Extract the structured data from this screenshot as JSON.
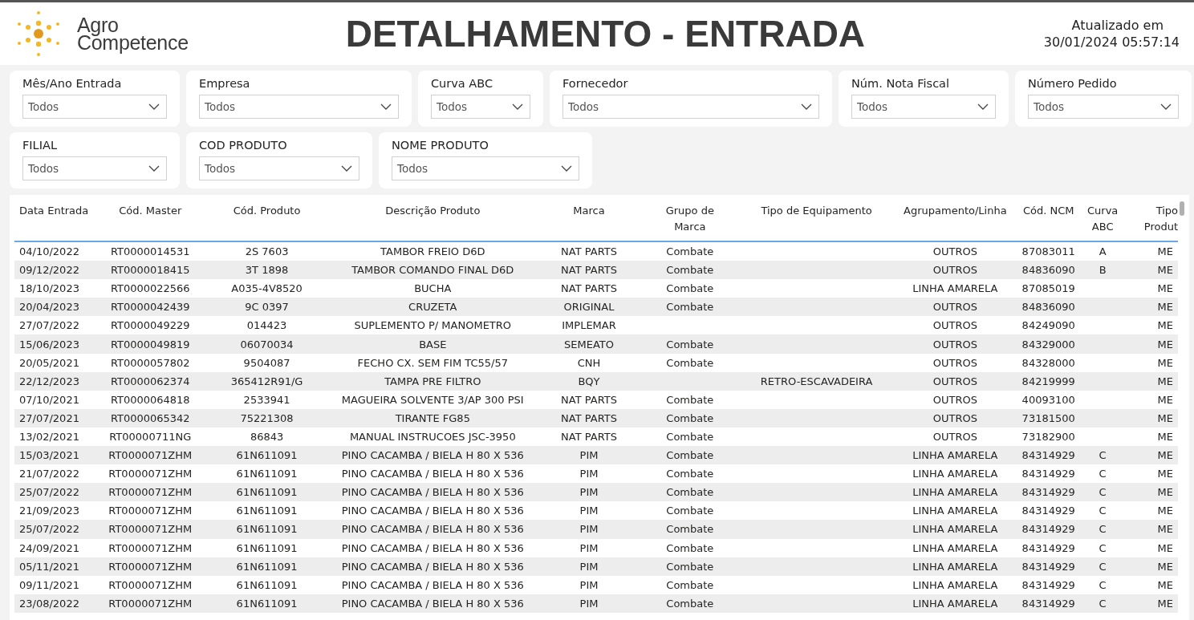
{
  "logo": {
    "line_1": "Agro",
    "line_2": "Competence"
  },
  "title": "DETALHAMENTO - ENTRADA",
  "updated": {
    "label": "Atualizado em",
    "value": "30/01/2024 05:57:14"
  },
  "filter_rows": [
    [
      {
        "label": "Mês/Ano Entrada",
        "value": "Todos"
      },
      {
        "label": "Empresa",
        "value": "Todos"
      },
      {
        "label": "Curva ABC",
        "value": "Todos"
      },
      {
        "label": "Fornecedor",
        "value": "Todos"
      },
      {
        "label": "Núm. Nota Fiscal",
        "value": "Todos"
      },
      {
        "label": "Número Pedido",
        "value": "Todos"
      }
    ],
    [
      {
        "label": "FILIAL",
        "value": "Todos"
      },
      {
        "label": "COD PRODUTO",
        "value": "Todos"
      },
      {
        "label": "NOME PRODUTO",
        "value": "Todos"
      }
    ]
  ],
  "table": {
    "columns": [
      "Data Entrada",
      "Cód. Master",
      "Cód. Produto",
      "Descrição Produto",
      "Marca",
      "Grupo de Marca",
      "Tipo de Equipamento",
      "Agrupamento/Linha",
      "Cód. NCM",
      "Curva ABC",
      "Tipo Produt"
    ],
    "rows": [
      {
        "date": "04/10/2022",
        "master": "RT0000014531",
        "product_code": "2S 7603",
        "description": "TAMBOR FREIO D6D",
        "brand": "NAT PARTS",
        "brand_group": "Combate",
        "line": "OUTROS",
        "ncm": "87083011",
        "abc": "A",
        "product_type": "ME"
      },
      {
        "date": "09/12/2022",
        "master": "RT0000018415",
        "product_code": "3T 1898",
        "description": "TAMBOR COMANDO FINAL D6D",
        "brand": "NAT PARTS",
        "brand_group": "Combate",
        "line": "OUTROS",
        "ncm": "84836090",
        "abc": "B",
        "product_type": "ME"
      },
      {
        "date": "18/10/2023",
        "master": "RT0000022566",
        "product_code": "A035-4V8520",
        "description": "BUCHA",
        "brand": "NAT PARTS",
        "brand_group": "Combate",
        "line": "LINHA AMARELA",
        "ncm": "87085019",
        "product_type": "ME"
      },
      {
        "date": "20/04/2023",
        "master": "RT0000042439",
        "product_code": "9C 0397",
        "description": "CRUZETA",
        "brand": "ORIGINAL",
        "brand_group": "Combate",
        "line": "OUTROS",
        "ncm": "84836090",
        "product_type": "ME"
      },
      {
        "date": "27/07/2022",
        "master": "RT0000049229",
        "product_code": "014423",
        "description": "SUPLEMENTO P/ MANOMETRO",
        "brand": "IMPLEMAR",
        "line": "OUTROS",
        "ncm": "84249090",
        "product_type": "ME"
      },
      {
        "date": "15/06/2023",
        "master": "RT0000049819",
        "product_code": "06070034",
        "description": "BASE",
        "brand": "SEMEATO",
        "brand_group": "Combate",
        "line": "OUTROS",
        "ncm": "84329000",
        "product_type": "ME"
      },
      {
        "date": "20/05/2021",
        "master": "RT0000057802",
        "product_code": "9504087",
        "description": "FECHO CX. SEM FIM TC55/57",
        "brand": "CNH",
        "brand_group": "Combate",
        "line": "OUTROS",
        "ncm": "84328000",
        "product_type": "ME"
      },
      {
        "date": "22/12/2023",
        "master": "RT0000062374",
        "product_code": "365412R91/G",
        "description": "TAMPA PRE FILTRO",
        "brand": "BQY",
        "equipment_type": "RETRO-ESCAVADEIRA",
        "line": "OUTROS",
        "ncm": "84219999",
        "product_type": "ME"
      },
      {
        "date": "07/10/2021",
        "master": "RT0000064818",
        "product_code": "2533941",
        "description": "MAGUEIRA SOLVENTE 3/AP 300 PSI",
        "brand": "NAT PARTS",
        "brand_group": "Combate",
        "line": "OUTROS",
        "ncm": "40093100",
        "product_type": "ME"
      },
      {
        "date": "27/07/2021",
        "master": "RT0000065342",
        "product_code": "75221308",
        "description": "TIRANTE FG85",
        "brand": "NAT PARTS",
        "brand_group": "Combate",
        "line": "OUTROS",
        "ncm": "73181500",
        "product_type": "ME"
      },
      {
        "date": "13/02/2021",
        "master": "RT00000711NG",
        "product_code": "86843",
        "description": "MANUAL INSTRUCOES JSC-3950",
        "brand": "NAT PARTS",
        "brand_group": "Combate",
        "line": "OUTROS",
        "ncm": "73182900",
        "product_type": "ME"
      },
      {
        "date": "15/03/2021",
        "master": "RT0000071ZHM",
        "product_code": "61N611091",
        "description": "PINO CACAMBA / BIELA H 80 X 536",
        "brand": "PIM",
        "brand_group": "Combate",
        "line": "LINHA AMARELA",
        "ncm": "84314929",
        "abc": "C",
        "product_type": "ME"
      },
      {
        "date": "21/07/2022",
        "master": "RT0000071ZHM",
        "product_code": "61N611091",
        "description": "PINO CACAMBA / BIELA H 80 X 536",
        "brand": "PIM",
        "brand_group": "Combate",
        "line": "LINHA AMARELA",
        "ncm": "84314929",
        "abc": "C",
        "product_type": "ME"
      },
      {
        "date": "25/07/2022",
        "master": "RT0000071ZHM",
        "product_code": "61N611091",
        "description": "PINO CACAMBA / BIELA H 80 X 536",
        "brand": "PIM",
        "brand_group": "Combate",
        "line": "LINHA AMARELA",
        "ncm": "84314929",
        "abc": "C",
        "product_type": "ME"
      },
      {
        "date": "21/09/2023",
        "master": "RT0000071ZHM",
        "product_code": "61N611091",
        "description": "PINO CACAMBA / BIELA H 80 X 536",
        "brand": "PIM",
        "brand_group": "Combate",
        "line": "LINHA AMARELA",
        "ncm": "84314929",
        "abc": "C",
        "product_type": "ME"
      },
      {
        "date": "25/07/2022",
        "master": "RT0000071ZHM",
        "product_code": "61N611091",
        "description": "PINO CACAMBA / BIELA H 80 X 536",
        "brand": "PIM",
        "brand_group": "Combate",
        "line": "LINHA AMARELA",
        "ncm": "84314929",
        "abc": "C",
        "product_type": "ME"
      },
      {
        "date": "24/09/2021",
        "master": "RT0000071ZHM",
        "product_code": "61N611091",
        "description": "PINO CACAMBA / BIELA H 80 X 536",
        "brand": "PIM",
        "brand_group": "Combate",
        "line": "LINHA AMARELA",
        "ncm": "84314929",
        "abc": "C",
        "product_type": "ME"
      },
      {
        "date": "05/11/2021",
        "master": "RT0000071ZHM",
        "product_code": "61N611091",
        "description": "PINO CACAMBA / BIELA H 80 X 536",
        "brand": "PIM",
        "brand_group": "Combate",
        "line": "LINHA AMARELA",
        "ncm": "84314929",
        "abc": "C",
        "product_type": "ME"
      },
      {
        "date": "09/11/2021",
        "master": "RT0000071ZHM",
        "product_code": "61N611091",
        "description": "PINO CACAMBA / BIELA H 80 X 536",
        "brand": "PIM",
        "brand_group": "Combate",
        "line": "LINHA AMARELA",
        "ncm": "84314929",
        "abc": "C",
        "product_type": "ME"
      },
      {
        "date": "23/08/2022",
        "master": "RT0000071ZHM",
        "product_code": "61N611091",
        "description": "PINO CACAMBA / BIELA H 80 X 536",
        "brand": "PIM",
        "brand_group": "Combate",
        "line": "LINHA AMARELA",
        "ncm": "84314929",
        "abc": "C",
        "product_type": "ME"
      }
    ]
  }
}
